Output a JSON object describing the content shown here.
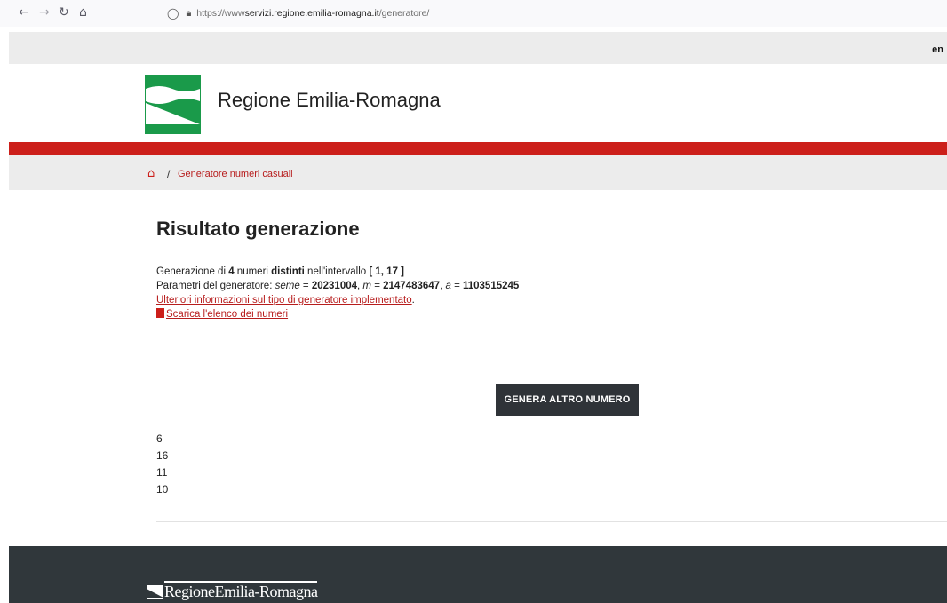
{
  "browser": {
    "url_prefix": "https://www",
    "url_host": "servizi.regione.emilia-romagna.it",
    "url_path": "/generatore/"
  },
  "topbar": {
    "lang": "en"
  },
  "site": {
    "title": "Regione Emilia-Romagna"
  },
  "breadcrumb": {
    "separator": "/",
    "current": "Generatore numeri casuali"
  },
  "main": {
    "heading": "Risultato generazione",
    "line1": {
      "pre": "Generazione di ",
      "count": "4",
      "mid1": " numeri ",
      "distinct": "distinti",
      "mid2": " nell'intervallo ",
      "range": "[ 1, 17 ]"
    },
    "line2": {
      "pre": "Parametri del generatore: ",
      "seed_label": "seme",
      "eq1": " = ",
      "seed": "20231004",
      "sep1": ", ",
      "m_label": "m",
      "eq2": " = ",
      "m": "2147483647",
      "sep2": ", ",
      "a_label": "a",
      "eq3": " = ",
      "a": "1103515245"
    },
    "info_link": "Ulteriori informazioni sul tipo di generatore implementato",
    "info_link_suffix": ".",
    "download_link": "Scarica l'elenco dei numeri",
    "button": "GENERA ALTRO NUMERO",
    "numbers": [
      "6",
      "16",
      "11",
      "10"
    ]
  },
  "footer": {
    "logo_text": "RegioneEmilia-Romagna"
  },
  "colors": {
    "accent_red": "#cc1f1a",
    "footer_bg": "#30373b",
    "logo_green": "#1a9a4a"
  },
  "icons": [
    "back-arrow-icon",
    "forward-arrow-icon",
    "reload-icon",
    "home-nav-icon",
    "shield-icon",
    "lock-icon",
    "home-icon",
    "pdf-file-icon"
  ]
}
